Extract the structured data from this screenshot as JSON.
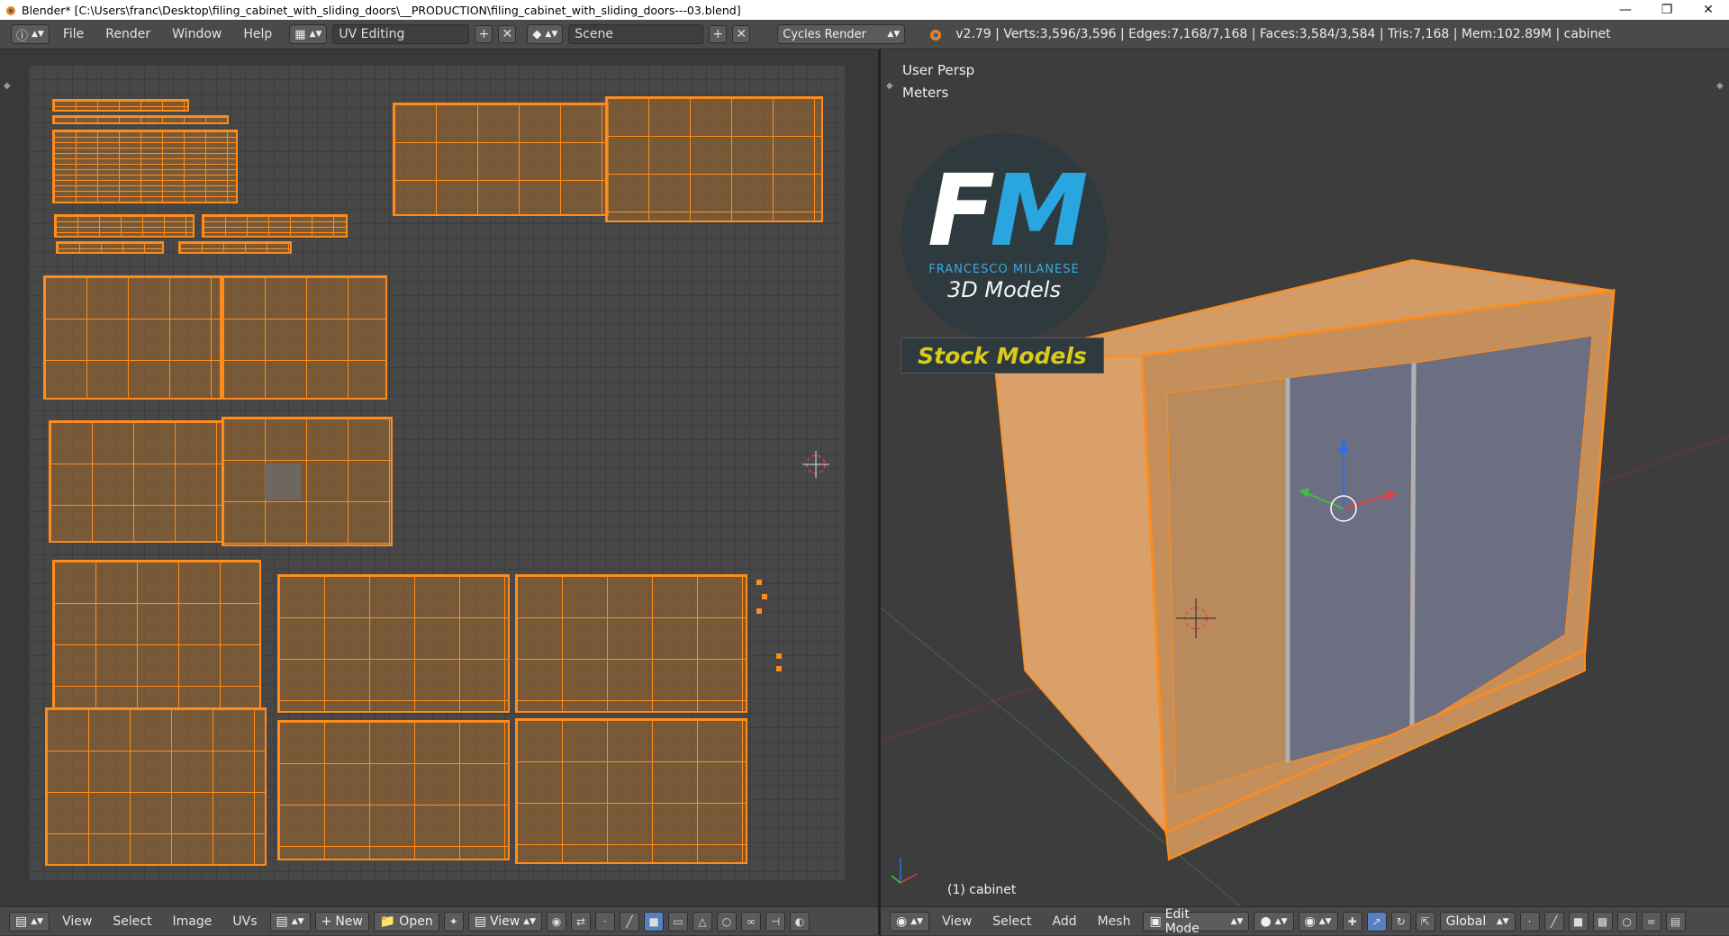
{
  "window": {
    "title": "Blender* [C:\\Users\\franc\\Desktop\\filing_cabinet_with_sliding_doors\\__PRODUCTION\\filing_cabinet_with_sliding_doors---03.blend]",
    "minimize_icon": "minimize-icon",
    "maximize_icon": "restore-icon",
    "close_icon": "close-icon"
  },
  "info_header": {
    "menus": [
      "File",
      "Render",
      "Window",
      "Help"
    ],
    "layout_value": "UV Editing",
    "scene_value": "Scene",
    "render_engine": "Cycles Render",
    "stats": "v2.79 | Verts:3,596/3,596 | Edges:7,168/7,168 | Faces:3,584/3,584 | Tris:7,168 | Mem:102.89M | cabinet"
  },
  "uv_editor": {
    "footer_menus": [
      "View",
      "Select",
      "Image",
      "UVs"
    ],
    "new_label": "New",
    "open_label": "Open",
    "view_label": "View"
  },
  "viewport": {
    "view_name": "User Persp",
    "units": "Meters",
    "logo_initials_f": "F",
    "logo_initials_m": "M",
    "logo_author": "FRANCESCO MILANESE",
    "logo_sub": "3D Models",
    "badge": "Stock Models",
    "object_label": "(1) cabinet",
    "footer_menus": [
      "View",
      "Select",
      "Add",
      "Mesh"
    ],
    "mode": "Edit Mode",
    "orientation": "Global"
  },
  "colors": {
    "selection": "#ff8c1a",
    "panel": "#4a4a4a",
    "uv_background": "#474747",
    "badge_text": "#d8cc1a",
    "logo_blue": "#29a6e0"
  }
}
